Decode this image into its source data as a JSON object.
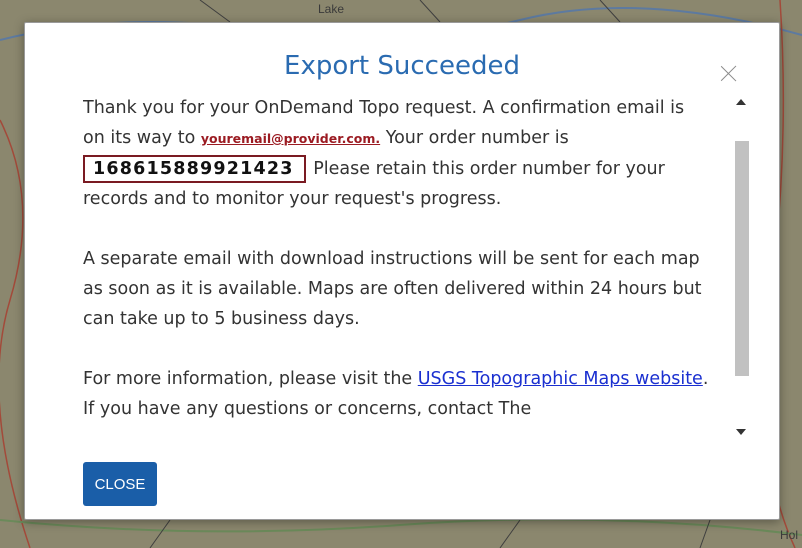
{
  "background": {
    "map_labels": [
      "Lake",
      "Hol"
    ]
  },
  "dialog": {
    "title": "Export Succeeded",
    "paragraph1": {
      "part1": "Thank you for your OnDemand Topo request. A confirmation email is on its way to ",
      "email": "youremail@provider.com.",
      "part2": " Your order number is",
      "order_number": "168615889921423",
      "part3": " Please retain this order number for your records and to monitor your request's progress."
    },
    "paragraph2": "A separate email with download instructions will be sent for each map as soon as it is available. Maps are often delivered within 24 hours but can take up to 5 business days.",
    "paragraph3": {
      "part1": "For more information, please visit the ",
      "link": "USGS Topographic Maps website",
      "part2": ". If you have any questions or concerns, contact The"
    },
    "close_button": "CLOSE",
    "icons": {
      "dismiss": "close-icon",
      "scroll_up": "scroll-up-arrow-icon",
      "scroll_down": "scroll-down-arrow-icon"
    },
    "colors": {
      "title": "#2a6bb1",
      "email": "#9b1b22",
      "order_box_border": "#7a1a22",
      "link": "#1a2fd0",
      "button": "#1a5ea8"
    }
  }
}
